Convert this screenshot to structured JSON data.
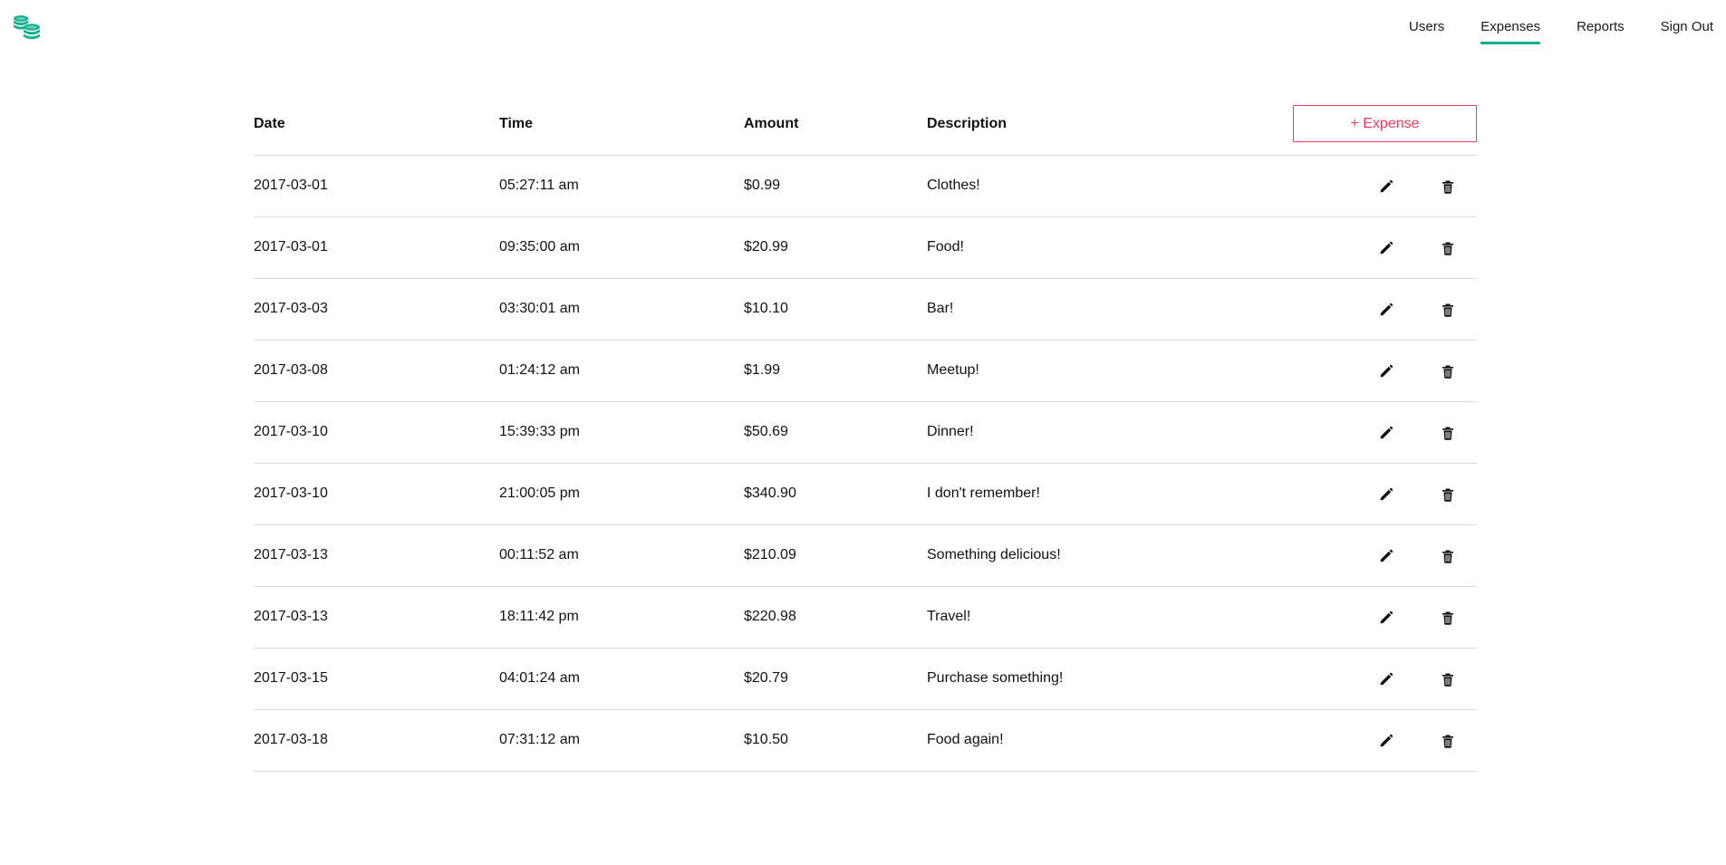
{
  "brand": {
    "icon": "coins-stack-icon",
    "color": "#13b08f"
  },
  "nav": {
    "users": "Users",
    "expenses": "Expenses",
    "reports": "Reports",
    "sign_out": "Sign Out",
    "active": "Expenses"
  },
  "table": {
    "headers": {
      "date": "Date",
      "time": "Time",
      "amount": "Amount",
      "description": "Description"
    },
    "add_button": "+ Expense",
    "accent_color": "#ee3b5b",
    "row_actions": {
      "edit_icon": "pencil-icon",
      "delete_icon": "trash-icon"
    },
    "rows": [
      {
        "date": "2017-03-01",
        "time": "05:27:11 am",
        "amount": "$0.99",
        "description": "Clothes!"
      },
      {
        "date": "2017-03-01",
        "time": "09:35:00 am",
        "amount": "$20.99",
        "description": "Food!"
      },
      {
        "date": "2017-03-03",
        "time": "03:30:01 am",
        "amount": "$10.10",
        "description": "Bar!"
      },
      {
        "date": "2017-03-08",
        "time": "01:24:12 am",
        "amount": "$1.99",
        "description": "Meetup!"
      },
      {
        "date": "2017-03-10",
        "time": "15:39:33 pm",
        "amount": "$50.69",
        "description": "Dinner!"
      },
      {
        "date": "2017-03-10",
        "time": "21:00:05 pm",
        "amount": "$340.90",
        "description": "I don't remember!"
      },
      {
        "date": "2017-03-13",
        "time": "00:11:52 am",
        "amount": "$210.09",
        "description": "Something delicious!"
      },
      {
        "date": "2017-03-13",
        "time": "18:11:42 pm",
        "amount": "$220.98",
        "description": "Travel!"
      },
      {
        "date": "2017-03-15",
        "time": "04:01:24 am",
        "amount": "$20.79",
        "description": "Purchase something!"
      },
      {
        "date": "2017-03-18",
        "time": "07:31:12 am",
        "amount": "$10.50",
        "description": "Food again!"
      }
    ]
  }
}
